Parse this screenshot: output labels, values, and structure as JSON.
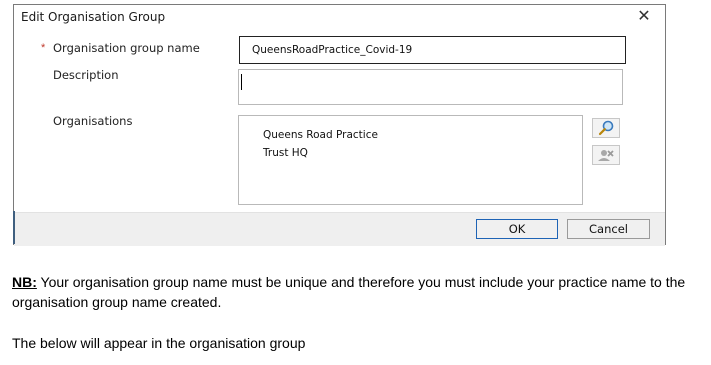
{
  "dialog": {
    "title": "Edit Organisation Group",
    "close_glyph": "✕",
    "fields": {
      "required_marker": "*",
      "name_label": "Organisation group name",
      "name_value": "QueensRoadPractice_Covid-19",
      "description_label": "Description",
      "description_value": "",
      "organisations_label": "Organisations",
      "organisations": [
        "Queens Road Practice",
        "Trust HQ"
      ]
    },
    "icons": {
      "search": "search-icon",
      "remove": "remove-icon"
    },
    "buttons": {
      "ok": "OK",
      "cancel": "Cancel"
    }
  },
  "note": {
    "prefix": "NB:",
    "text": " Your organisation group name must be unique and therefore you must include your practice name to the organisation group name created.",
    "below": "The below will appear in the organisation group"
  }
}
